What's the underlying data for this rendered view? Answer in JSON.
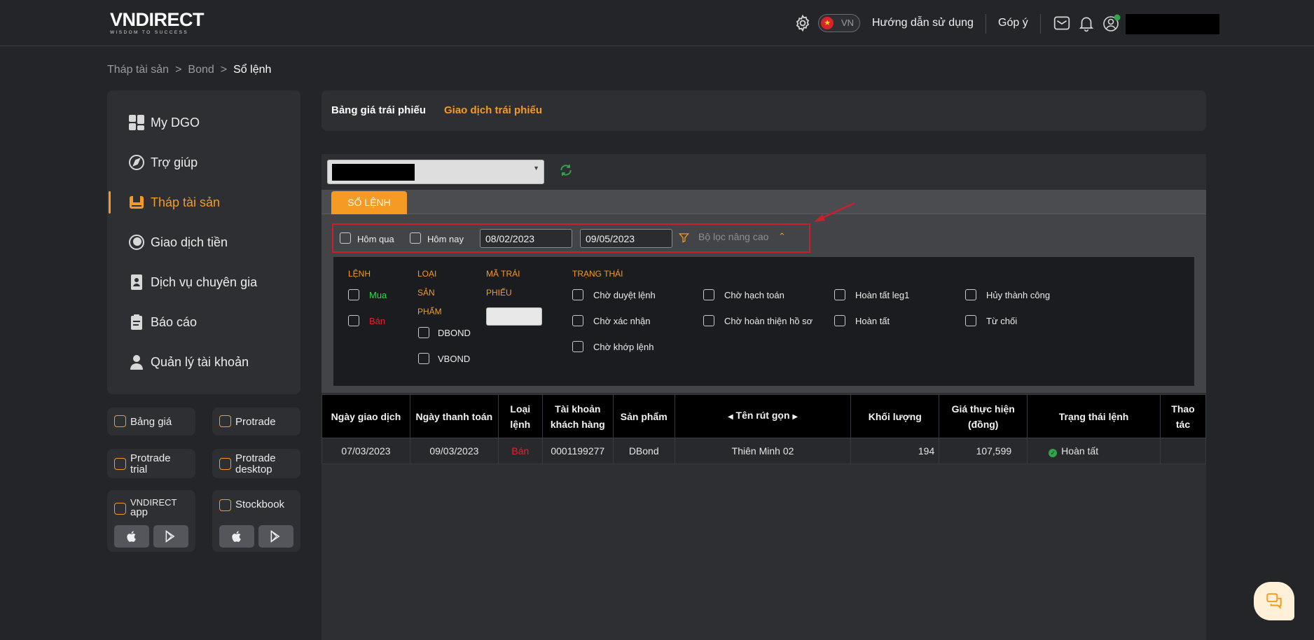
{
  "header": {
    "logo_word": "VNDIRECT",
    "logo_tagline": "WISDOM TO SUCCESS",
    "language_code": "VN",
    "guide_link": "Hướng dẫn sử dụng",
    "feedback_link": "Góp ý"
  },
  "breadcrumb": {
    "items": [
      "Tháp tài sản",
      "Bond",
      "Sổ lệnh"
    ],
    "separator": ">"
  },
  "sidebar": {
    "items": [
      {
        "label": "My DGO",
        "icon": "dashboard-icon"
      },
      {
        "label": "Trợ giúp",
        "icon": "help-icon"
      },
      {
        "label": "Tháp tài sản",
        "icon": "wallet-icon",
        "active": true
      },
      {
        "label": "Giao dịch tiền",
        "icon": "money-icon"
      },
      {
        "label": "Dịch vụ chuyên gia",
        "icon": "expert-icon"
      },
      {
        "label": "Báo cáo",
        "icon": "report-icon"
      },
      {
        "label": "Quản lý tài khoản",
        "icon": "user-icon"
      }
    ],
    "quick_links": {
      "bang_gia": "Bảng giá",
      "protrade": "Protrade",
      "protrade_trial_1": "Protrade",
      "protrade_trial_2": "trial",
      "protrade_desktop_1": "Protrade",
      "protrade_desktop_2": "desktop",
      "vndirect_app_1": "VNDIRECT",
      "vndirect_app_2": "app",
      "stockbook": "Stockbook"
    }
  },
  "tabs": {
    "price_board": "Bảng giá trái phiếu",
    "bond_trading": "Giao dịch trái phiếu"
  },
  "order_book": {
    "tab_label": "SỔ LỆNH",
    "filters": {
      "yesterday": "Hôm qua",
      "today": "Hôm nay",
      "from_date": "08/02/2023",
      "to_date": "09/05/2023",
      "advanced_filter": "Bộ lọc nâng cao"
    },
    "advanced": {
      "order_header": "LỆNH",
      "buy": "Mua",
      "sell": "Bán",
      "product_type_1": "LOẠI",
      "product_type_2": "SẢN",
      "product_type_3": "PHẨM",
      "dbond": "DBOND",
      "vbond": "VBOND",
      "bond_code_1": "MÃ TRÁI",
      "bond_code_2": "PHIẾU",
      "status_header": "TRẠNG THÁI",
      "statuses": [
        "Chờ duyệt lệnh",
        "Chờ hạch toán",
        "Hoàn tất leg1",
        "Hủy thành công",
        "Chờ xác nhận",
        "Chờ hoàn thiện hồ sơ",
        "Hoàn tất",
        "Từ chối",
        "Chờ khớp lệnh"
      ]
    },
    "table": {
      "headers": {
        "trade_date": "Ngày giao dịch",
        "settle_date": "Ngày thanh toán",
        "order_type_1": "Loại",
        "order_type_2": "lệnh",
        "account_1": "Tài khoản",
        "account_2": "khách hàng",
        "product": "Sản phẩm",
        "short_name": "Tên rút gọn",
        "volume": "Khối lượng",
        "price_1": "Giá thực hiện",
        "price_2": "(đồng)",
        "status": "Trạng thái lệnh",
        "action_1": "Thao",
        "action_2": "tác"
      },
      "rows": [
        {
          "trade_date": "07/03/2023",
          "settle_date": "09/03/2023",
          "order_type": "Bán",
          "account": "0001199277",
          "product": "DBond",
          "short_name": "Thiên Minh 02",
          "volume": "194",
          "price": "107,599",
          "status": "Hoàn tất",
          "action": ""
        }
      ]
    }
  },
  "colors": {
    "accent": "#f59a23",
    "sell": "#e2242b",
    "buy": "#2ed84e",
    "annotation": "#c8202d"
  }
}
